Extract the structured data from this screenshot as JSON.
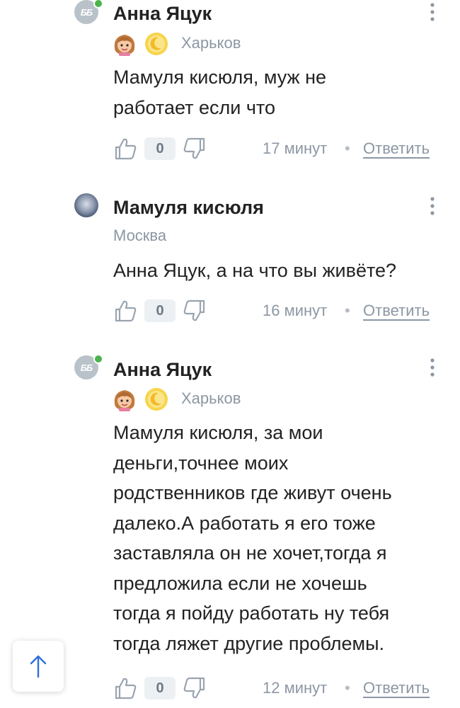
{
  "comments": [
    {
      "author": "Анна Яцук",
      "city": "Харьков",
      "avatar_text": "ББ",
      "text": "Мамуля кисюля, муж не\nработает если что",
      "likes": "0",
      "time": "17 минут",
      "separator": "•",
      "reply": "Ответить"
    },
    {
      "author": "Мамуля кисюля",
      "city": "Москва",
      "text": "Анна Яцук, а на что вы живёте?",
      "likes": "0",
      "time": "16 минут",
      "separator": "•",
      "reply": "Ответить"
    },
    {
      "author": "Анна Яцук",
      "city": "Харьков",
      "avatar_text": "ББ",
      "text": "Мамуля кисюля, за мои\nденьги,точнее моих\nродственников где живут очень\nдалеко.А работать я его тоже\nзаставляла он не хочет,тогда я\nпредложила если не хочешь\nтогда я пойду работать ну тебя\nтогда ляжет другие проблемы.",
      "likes": "0",
      "time": "12 минут",
      "separator": "•",
      "reply": "Ответить"
    }
  ],
  "icons": {
    "like": "thumb-up-icon",
    "dislike": "thumb-down-icon",
    "more": "more-vertical-icon",
    "scroll_top": "arrow-up-icon"
  },
  "colors": {
    "text": "#222222",
    "muted": "#8c97a3",
    "online": "#4bb34b",
    "count_bg": "#edf0f3"
  }
}
